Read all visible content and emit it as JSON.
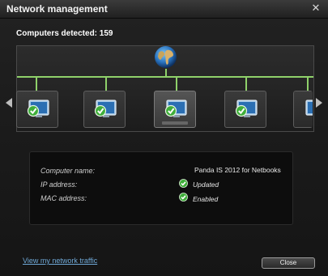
{
  "window": {
    "title": "Network management"
  },
  "summary": {
    "detected_text": "Computers detected: 159"
  },
  "info": {
    "labels": {
      "computer_name": "Computer name:",
      "ip_address": "IP address:",
      "mac_address": "MAC address:"
    },
    "product": "Panda IS 2012 for Netbooks",
    "status_updated": "Updated",
    "status_enabled": "Enabled"
  },
  "footer": {
    "link_text": "View my network traffic",
    "close_label": "Close"
  },
  "colors": {
    "network_line": "#8fd16a",
    "check_green": "#3fae3a",
    "link": "#6fa8d6"
  }
}
